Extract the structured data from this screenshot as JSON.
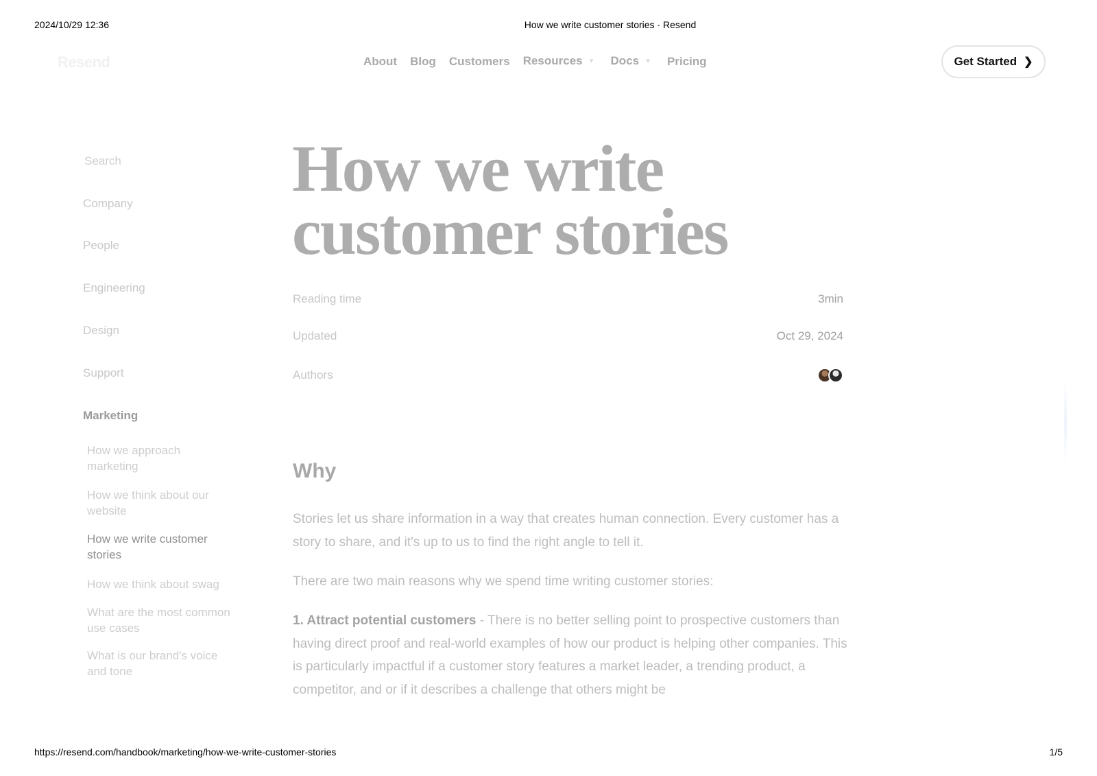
{
  "print": {
    "datetime": "2024/10/29 12:36",
    "doc_title": "How we write customer stories · Resend",
    "url": "https://resend.com/handbook/marketing/how-we-write-customer-stories",
    "page": "1/5"
  },
  "header": {
    "logo": "Resend",
    "nav": [
      {
        "label": "About"
      },
      {
        "label": "Blog"
      },
      {
        "label": "Customers"
      },
      {
        "label": "Resources"
      },
      {
        "label": "Docs"
      },
      {
        "label": "Pricing"
      }
    ],
    "cta_label": "Get Started"
  },
  "sidebar": {
    "search_placeholder": "Search",
    "categories": [
      "Company",
      "People",
      "Engineering",
      "Design",
      "Support",
      "Marketing"
    ],
    "marketing_items": [
      "How we approach marketing",
      "How we think about our website",
      "How we write customer stories",
      "How we think about swag",
      "What are the most common use cases",
      "What is our brand's voice and tone"
    ]
  },
  "article": {
    "title_line1": "How we write",
    "title_line2": "customer stories",
    "meta": {
      "reading_label": "Reading time",
      "reading_value": "3min",
      "updated_label": "Updated",
      "updated_value": "Oct 29, 2024",
      "authors_label": "Authors"
    },
    "section_heading": "Why",
    "p1": "Stories let us share information in a way that creates human connection. Every customer has a story to share, and it's up to us to find the right angle to tell it.",
    "p2": "There are two main reasons why we spend time writing customer stories:",
    "p3_bold": "1. Attract potential customers",
    "p3_rest": " - There is no better selling point to prospective customers than having direct proof and real-world examples of how our product is helping other companies. This is particularly impactful if a customer story features a market leader, a trending product, a competitor, and or if it describes a challenge that others might be"
  }
}
